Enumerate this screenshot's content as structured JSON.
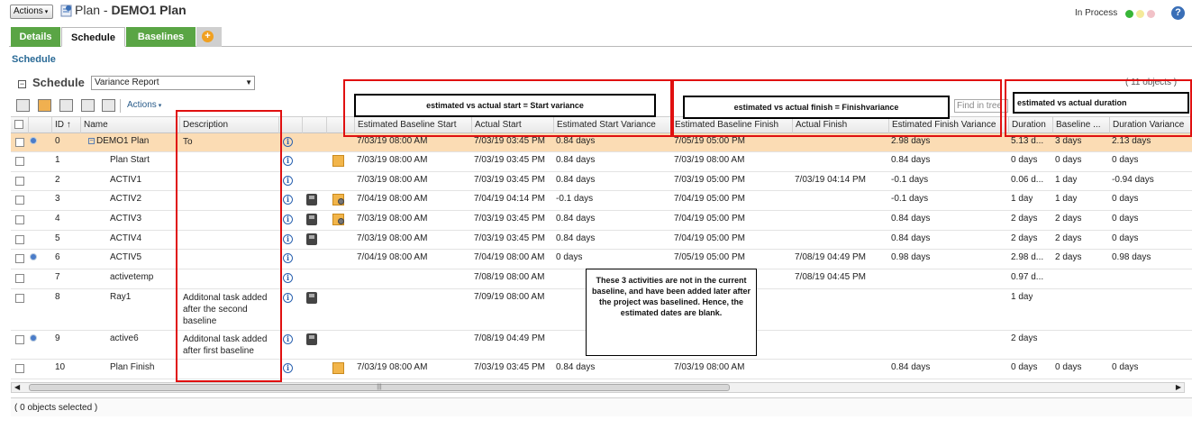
{
  "header": {
    "actions_label": "Actions",
    "title_prefix": "Plan - ",
    "title_name": "DEMO1 Plan",
    "status": "In Process",
    "help": "?"
  },
  "tabs": [
    {
      "label": "Details"
    },
    {
      "label": "Schedule"
    },
    {
      "label": "Baselines"
    }
  ],
  "breadcrumb": "Schedule",
  "schedule": {
    "label": "Schedule",
    "view": "Variance Report",
    "object_count": "( 11 objects )",
    "toolbar_actions": "Actions",
    "find_placeholder": "Find in tree"
  },
  "columns": {
    "id": "ID",
    "name": "Name",
    "description": "Description",
    "est_baseline_start": "Estimated Baseline Start",
    "actual_start": "Actual Start",
    "est_start_variance": "Estimated Start Variance",
    "est_baseline_finish": "Estimated Baseline Finish",
    "actual_finish": "Actual Finish",
    "est_finish_variance": "Estimated Finish Variance",
    "duration": "Duration",
    "baseline_duration": "Baseline ...",
    "duration_variance": "Duration Variance"
  },
  "rows": [
    {
      "id": "0",
      "name": "DEMO1 Plan",
      "desc": "To",
      "bs": "7/03/19 08:00 AM",
      "as": "7/03/19 03:45 PM",
      "sv": "0.84 days",
      "bf": "7/05/19 05:00 PM",
      "af": "",
      "fv": "2.98 days",
      "dur": "5.13 d...",
      "bd": "3 days",
      "dv": "2.13 days"
    },
    {
      "id": "1",
      "name": "Plan Start",
      "desc": "",
      "bs": "7/03/19 08:00 AM",
      "as": "7/03/19 03:45 PM",
      "sv": "0.84 days",
      "bf": "7/03/19 08:00 AM",
      "af": "",
      "fv": "0.84 days",
      "dur": "0 days",
      "bd": "0 days",
      "dv": "0 days"
    },
    {
      "id": "2",
      "name": "ACTIV1",
      "desc": "",
      "bs": "7/03/19 08:00 AM",
      "as": "7/03/19 03:45 PM",
      "sv": "0.84 days",
      "bf": "7/03/19 05:00 PM",
      "af": "7/03/19 04:14 PM",
      "fv": "-0.1 days",
      "dur": "0.06 d...",
      "bd": "1 day",
      "dv": "-0.94 days"
    },
    {
      "id": "3",
      "name": "ACTIV2",
      "desc": "",
      "bs": "7/04/19 08:00 AM",
      "as": "7/04/19 04:14 PM",
      "sv": "-0.1 days",
      "bf": "7/04/19 05:00 PM",
      "af": "",
      "fv": "-0.1 days",
      "dur": "1 day",
      "bd": "1 day",
      "dv": "0 days"
    },
    {
      "id": "4",
      "name": "ACTIV3",
      "desc": "",
      "bs": "7/03/19 08:00 AM",
      "as": "7/03/19 03:45 PM",
      "sv": "0.84 days",
      "bf": "7/04/19 05:00 PM",
      "af": "",
      "fv": "0.84 days",
      "dur": "2 days",
      "bd": "2 days",
      "dv": "0 days"
    },
    {
      "id": "5",
      "name": "ACTIV4",
      "desc": "",
      "bs": "7/03/19 08:00 AM",
      "as": "7/03/19 03:45 PM",
      "sv": "0.84 days",
      "bf": "7/04/19 05:00 PM",
      "af": "",
      "fv": "0.84 days",
      "dur": "2 days",
      "bd": "2 days",
      "dv": "0 days"
    },
    {
      "id": "6",
      "name": "ACTIV5",
      "desc": "",
      "bs": "7/04/19 08:00 AM",
      "as": "7/04/19 08:00 AM",
      "sv": "0 days",
      "bf": "7/05/19 05:00 PM",
      "af": "7/08/19 04:49 PM",
      "fv": "0.98 days",
      "dur": "2.98 d...",
      "bd": "2 days",
      "dv": "0.98 days"
    },
    {
      "id": "7",
      "name": "activetemp",
      "desc": "",
      "bs": "",
      "as": "7/08/19 08:00 AM",
      "sv": "",
      "bf": "",
      "af": "7/08/19 04:45 PM",
      "fv": "",
      "dur": "0.97 d...",
      "bd": "",
      "dv": ""
    },
    {
      "id": "8",
      "name": "Ray1",
      "desc": "Additonal task added after the second baseline",
      "bs": "",
      "as": "7/09/19 08:00 AM",
      "sv": "",
      "bf": "",
      "af": "",
      "fv": "",
      "dur": "1 day",
      "bd": "",
      "dv": ""
    },
    {
      "id": "9",
      "name": "active6",
      "desc": "Additonal task added after first baseline",
      "bs": "",
      "as": "7/08/19 04:49 PM",
      "sv": "",
      "bf": "",
      "af": "",
      "fv": "",
      "dur": "2 days",
      "bd": "",
      "dv": ""
    },
    {
      "id": "10",
      "name": "Plan Finish",
      "desc": "",
      "bs": "7/03/19 08:00 AM",
      "as": "7/03/19 03:45 PM",
      "sv": "0.84 days",
      "bf": "7/03/19 08:00 AM",
      "af": "",
      "fv": "0.84 days",
      "dur": "0 days",
      "bd": "0 days",
      "dv": "0 days"
    }
  ],
  "annotations": {
    "start": "estimated vs actual start = Start variance",
    "finish": "estimated vs actual finish = Finishvariance",
    "duration": "estimated vs actual duration",
    "note": "These 3 activities are not in the current baseline, and have been added later after the project was baselined. Hence, the estimated dates are blank."
  },
  "footer": "( 0 objects selected )",
  "colors": {
    "tab_green": "#5aa545",
    "selected_row": "#fbdcb4",
    "annotation_red": "#e01010"
  }
}
